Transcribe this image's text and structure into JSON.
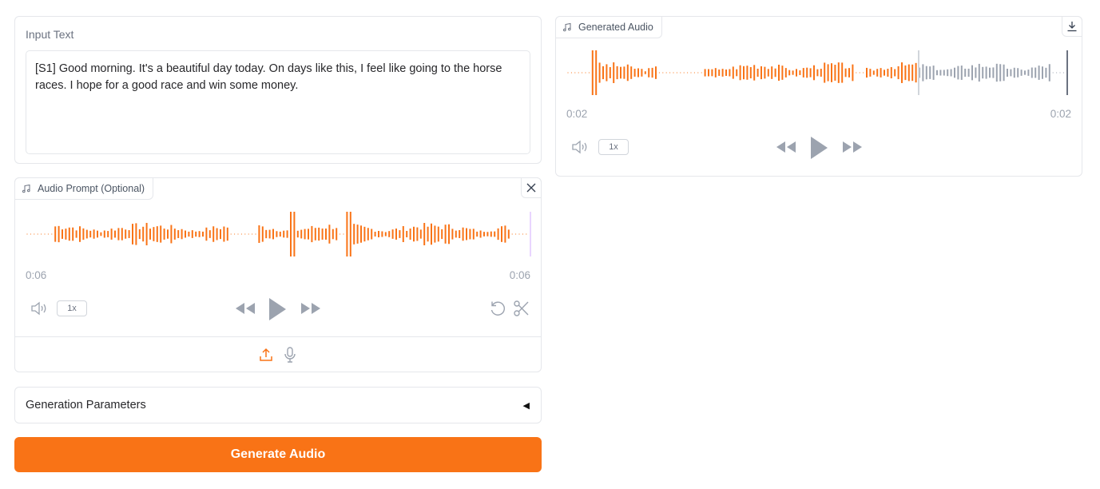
{
  "input_text": {
    "label": "Input Text",
    "value": "[S1] Good morning. It's a beautiful day today. On days like this, I feel like going to the horse races. I hope for a good race and win some money."
  },
  "audio_prompt": {
    "label": "Audio Prompt (Optional)",
    "time_current": "0:06",
    "time_total": "0:06",
    "speed": "1x",
    "progress": 1.0,
    "icons": {
      "tag": "music-note-icon",
      "clear": "close-icon",
      "volume": "volume-icon",
      "rewind": "rewind-icon",
      "play": "play-icon",
      "forward": "fast-forward-icon",
      "reset": "undo-icon",
      "trim": "scissors-icon",
      "upload": "upload-icon",
      "record": "microphone-icon"
    }
  },
  "generated_audio": {
    "label": "Generated Audio",
    "time_current": "0:02",
    "time_total": "0:02",
    "speed": "1x",
    "progress": 0.7,
    "icons": {
      "tag": "music-note-icon",
      "download": "download-icon",
      "volume": "volume-icon",
      "rewind": "rewind-icon",
      "play": "play-icon",
      "forward": "fast-forward-icon"
    }
  },
  "generation_parameters": {
    "label": "Generation Parameters",
    "collapse_indicator": "◀"
  },
  "generate_button": {
    "label": "Generate Audio"
  },
  "colors": {
    "accent": "#f97316",
    "played": "#f97316",
    "unplayed": "#9ca3af",
    "icon": "#9ca3af"
  }
}
